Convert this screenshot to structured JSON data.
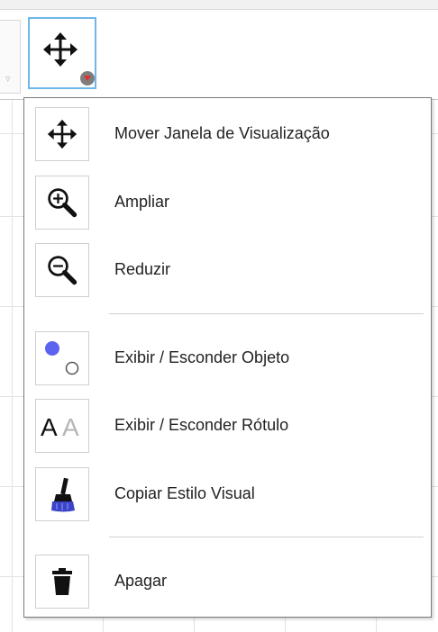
{
  "toolbar": {
    "active_tool_icon": "move-graphics-view-icon",
    "dropdown_icon": "dropdown-triangle-icon"
  },
  "menu": {
    "items": [
      {
        "label": "Mover Janela de Visualização",
        "icon": "move-graphics-view-icon"
      },
      {
        "label": "Ampliar",
        "icon": "zoom-in-icon"
      },
      {
        "label": "Reduzir",
        "icon": "zoom-out-icon"
      },
      {
        "label": "Exibir / Esconder Objeto",
        "icon": "show-hide-object-icon"
      },
      {
        "label": "Exibir / Esconder Rótulo",
        "icon": "show-hide-label-icon"
      },
      {
        "label": "Copiar Estilo Visual",
        "icon": "copy-visual-style-icon"
      },
      {
        "label": "Apagar",
        "icon": "delete-icon"
      }
    ]
  },
  "colors": {
    "active_border": "#6fb7ea",
    "dot_blue": "#5b63f0",
    "brush_blue": "#3b43c8",
    "dropdown_red": "#e03030"
  }
}
